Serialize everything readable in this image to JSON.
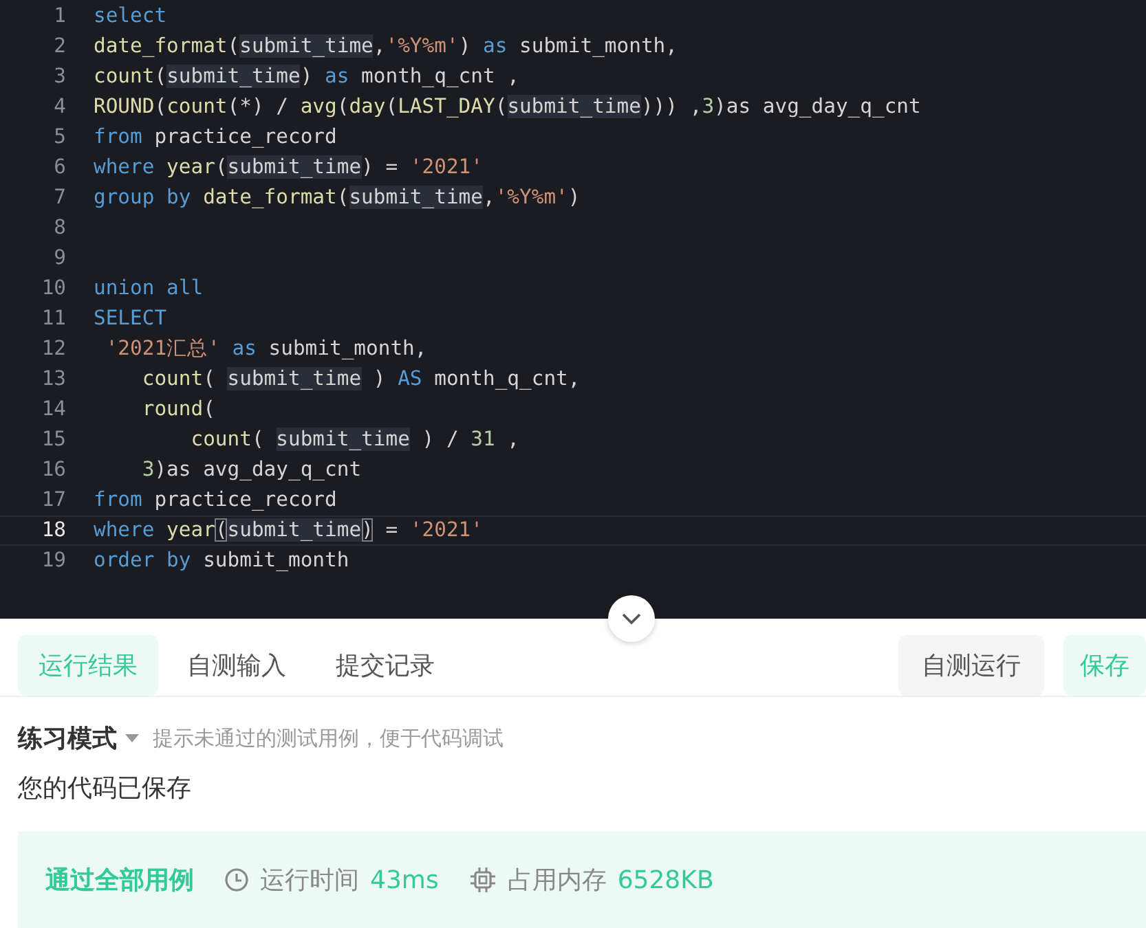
{
  "editor": {
    "lines": [
      {
        "number": "1",
        "current": false,
        "tokens": [
          {
            "kind": "kw",
            "text": "select"
          }
        ]
      },
      {
        "number": "2",
        "current": false,
        "tokens": [
          {
            "kind": "fn",
            "text": "date_format"
          },
          {
            "kind": "plain",
            "text": "("
          },
          {
            "kind": "var",
            "text": "submit_time"
          },
          {
            "kind": "plain",
            "text": ","
          },
          {
            "kind": "str",
            "text": "'%Y%m'"
          },
          {
            "kind": "plain",
            "text": ") "
          },
          {
            "kind": "kw",
            "text": "as"
          },
          {
            "kind": "plain",
            "text": " submit_month,"
          }
        ]
      },
      {
        "number": "3",
        "current": false,
        "tokens": [
          {
            "kind": "fn",
            "text": "count"
          },
          {
            "kind": "plain",
            "text": "("
          },
          {
            "kind": "var",
            "text": "submit_time"
          },
          {
            "kind": "plain",
            "text": ") "
          },
          {
            "kind": "kw",
            "text": "as"
          },
          {
            "kind": "plain",
            "text": " month_q_cnt ,"
          }
        ]
      },
      {
        "number": "4",
        "current": false,
        "tokens": [
          {
            "kind": "fn",
            "text": "ROUND"
          },
          {
            "kind": "plain",
            "text": "("
          },
          {
            "kind": "fn",
            "text": "count"
          },
          {
            "kind": "plain",
            "text": "(*) / "
          },
          {
            "kind": "fn",
            "text": "avg"
          },
          {
            "kind": "plain",
            "text": "("
          },
          {
            "kind": "fn",
            "text": "day"
          },
          {
            "kind": "plain",
            "text": "("
          },
          {
            "kind": "fn",
            "text": "LAST_DAY"
          },
          {
            "kind": "plain",
            "text": "("
          },
          {
            "kind": "var",
            "text": "submit_time"
          },
          {
            "kind": "plain",
            "text": "))) ,"
          },
          {
            "kind": "num",
            "text": "3"
          },
          {
            "kind": "plain",
            "text": ")as avg_day_q_cnt"
          }
        ]
      },
      {
        "number": "5",
        "current": false,
        "tokens": [
          {
            "kind": "kw",
            "text": "from"
          },
          {
            "kind": "plain",
            "text": " practice_record"
          }
        ]
      },
      {
        "number": "6",
        "current": false,
        "tokens": [
          {
            "kind": "kw",
            "text": "where"
          },
          {
            "kind": "fn",
            "text": " year"
          },
          {
            "kind": "plain",
            "text": "("
          },
          {
            "kind": "var",
            "text": "submit_time"
          },
          {
            "kind": "plain",
            "text": ") = "
          },
          {
            "kind": "str",
            "text": "'2021'"
          }
        ]
      },
      {
        "number": "7",
        "current": false,
        "tokens": [
          {
            "kind": "kw",
            "text": "group by"
          },
          {
            "kind": "fn",
            "text": " date_format"
          },
          {
            "kind": "plain",
            "text": "("
          },
          {
            "kind": "var",
            "text": "submit_time"
          },
          {
            "kind": "plain",
            "text": ","
          },
          {
            "kind": "str",
            "text": "'%Y%m'"
          },
          {
            "kind": "plain",
            "text": ")"
          }
        ]
      },
      {
        "number": "8",
        "current": false
      },
      {
        "number": "9",
        "current": false
      },
      {
        "number": "10",
        "current": false,
        "tokens": [
          {
            "kind": "kw",
            "text": "union all"
          }
        ]
      },
      {
        "number": "11",
        "current": false,
        "tokens": [
          {
            "kind": "kw",
            "text": "SELECT"
          }
        ]
      },
      {
        "number": "12",
        "current": false,
        "tokens": [
          {
            "kind": "str",
            "text": " '2021汇总'"
          },
          {
            "kind": "kw",
            "text": " as"
          },
          {
            "kind": "plain",
            "text": " submit_month,"
          }
        ]
      },
      {
        "number": "13",
        "current": false,
        "tokens": [
          {
            "kind": "fn",
            "text": "    count"
          },
          {
            "kind": "plain",
            "text": "( "
          },
          {
            "kind": "var",
            "text": "submit_time"
          },
          {
            "kind": "plain",
            "text": " ) "
          },
          {
            "kind": "kw",
            "text": "AS"
          },
          {
            "kind": "plain",
            "text": " month_q_cnt,"
          }
        ]
      },
      {
        "number": "14",
        "current": false,
        "tokens": [
          {
            "kind": "fn",
            "text": "    round"
          },
          {
            "kind": "plain",
            "text": "("
          }
        ]
      },
      {
        "number": "15",
        "current": false,
        "tokens": [
          {
            "kind": "fn",
            "text": "        count"
          },
          {
            "kind": "plain",
            "text": "( "
          },
          {
            "kind": "var",
            "text": "submit_time"
          },
          {
            "kind": "plain",
            "text": " ) / "
          },
          {
            "kind": "num",
            "text": "31"
          },
          {
            "kind": "plain",
            "text": " ,"
          }
        ]
      },
      {
        "number": "16",
        "current": false,
        "tokens": [
          {
            "kind": "num",
            "text": "    3"
          },
          {
            "kind": "plain",
            "text": ")as avg_day_q_cnt"
          }
        ]
      },
      {
        "number": "17",
        "current": false,
        "tokens": [
          {
            "kind": "kw",
            "text": "from"
          },
          {
            "kind": "plain",
            "text": " practice_record"
          }
        ]
      },
      {
        "number": "18",
        "current": true,
        "tokens": [
          {
            "kind": "kw",
            "text": "where"
          },
          {
            "kind": "fn",
            "text": " year"
          },
          {
            "kind": "match",
            "text": "("
          },
          {
            "kind": "var",
            "text": "submit_time"
          },
          {
            "kind": "match",
            "text": ")"
          },
          {
            "kind": "plain",
            "text": " = "
          },
          {
            "kind": "str",
            "text": "'2021'"
          }
        ]
      },
      {
        "number": "19",
        "current": false,
        "tokens": [
          {
            "kind": "kw",
            "text": "order by"
          },
          {
            "kind": "plain",
            "text": " submit_month"
          }
        ]
      }
    ]
  },
  "tabs": [
    {
      "label": "运行结果",
      "selected": true
    },
    {
      "label": "自测输入",
      "selected": false
    },
    {
      "label": "提交记录",
      "selected": false
    }
  ],
  "actions": [
    {
      "label": "自测运行",
      "kind": "secondary"
    },
    {
      "label": "保存",
      "kind": "primary"
    }
  ],
  "mode": {
    "label": "练习模式",
    "hint": "提示未通过的测试用例，便于代码调试"
  },
  "message": "您的代码已保存",
  "result": {
    "status": "通过全部用例",
    "time_label": "运行时间",
    "time_value": "43ms",
    "memory_label": "占用内存",
    "memory_value": "6528KB"
  }
}
